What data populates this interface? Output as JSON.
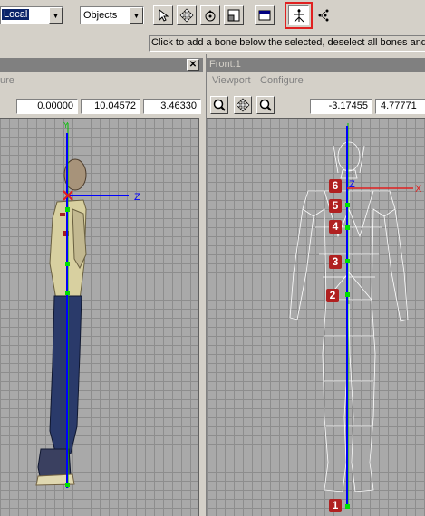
{
  "toolbar": {
    "coord_system": "Local",
    "selection_filter": "Objects",
    "tools": [
      "select-arrow-icon",
      "move-icon",
      "rotate-icon",
      "scale-icon",
      "window-icon",
      "create-bone-icon",
      "bone-hierarchy-icon"
    ]
  },
  "status": {
    "hint": "Click to add a bone below the selected, deselect all bones and c"
  },
  "left_viewport": {
    "menu_partial": "ure",
    "coords": [
      "0.00000",
      "10.04572",
      "3.46330"
    ],
    "axis_y": "Y",
    "axis_z": "Z"
  },
  "right_viewport": {
    "title": "Front:1",
    "menu": [
      "Viewport",
      "Configure"
    ],
    "coords": [
      "-3.17455",
      "4.77771"
    ],
    "axis_z": "Z",
    "axis_x": "X"
  },
  "bone_markers": [
    "6",
    "5",
    "4",
    "3",
    "2",
    "1"
  ],
  "colors": {
    "selected_red": "#e02020",
    "axis_blue": "#0000ff",
    "bone_green": "#00e000",
    "marker_red": "#b02020"
  }
}
